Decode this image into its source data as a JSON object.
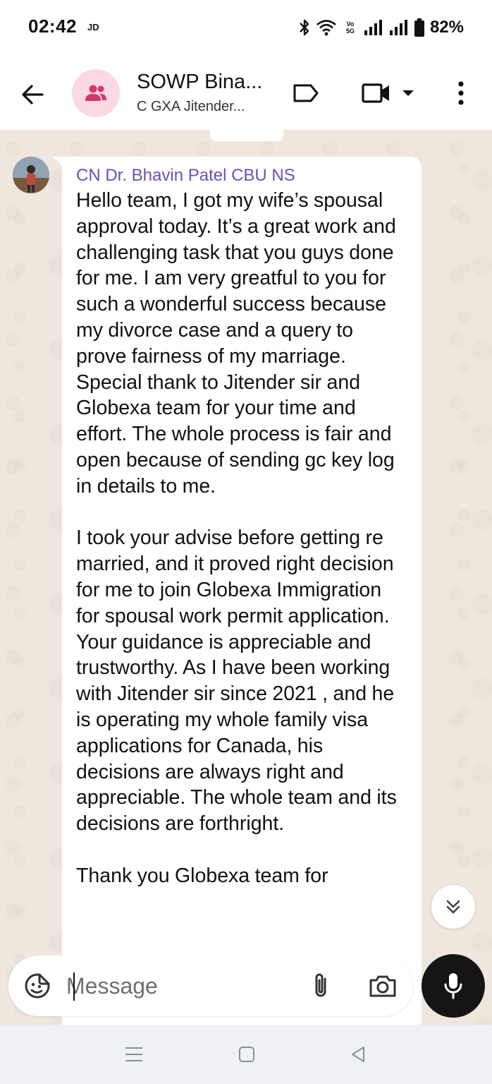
{
  "status_bar": {
    "time": "02:42",
    "carrier": "JD",
    "volte_top": "Vo",
    "volte_mid": "5G",
    "battery": "82%"
  },
  "header": {
    "title": "SOWP Bina...",
    "subtitle": "C GXA Jitender...",
    "icons": [
      "back-arrow-icon",
      "group-icon",
      "label-icon",
      "video-call-icon",
      "dropdown-icon",
      "more-vert-icon"
    ]
  },
  "message": {
    "sender": "CN Dr. Bhavin Patel CBU NS",
    "paragraphs": [
      "Hello team, I got my wife’s spousal approval today. It’s a great work and challenging task that you guys done for me. I am very greatful to you for such a wonderful success because my divorce case and a query to prove fairness of my marriage. Special thank to Jitender sir and Globexa team for your time and effort. The whole process is fair and open because of sending gc key log in details to me.",
      "I took your advise before getting re married, and it proved right decision for me to join Globexa Immigration for spousal work permit application. Your guidance is appreciable and trustworthy. As I have been working with Jitender sir since 2021 , and he is operating my whole family visa applications for Canada, his decisions are always right and appreciable. The whole team and its decisions are forthright.",
      "Thank you Globexa team for"
    ]
  },
  "composer": {
    "placeholder": "Message",
    "value": ""
  },
  "colors": {
    "sender_name": "#6b4fbb",
    "avatar_bg": "#fbd9e3",
    "group_icon": "#d7356b",
    "chat_bg": "#efe7dd",
    "mic_button": "#151515"
  }
}
